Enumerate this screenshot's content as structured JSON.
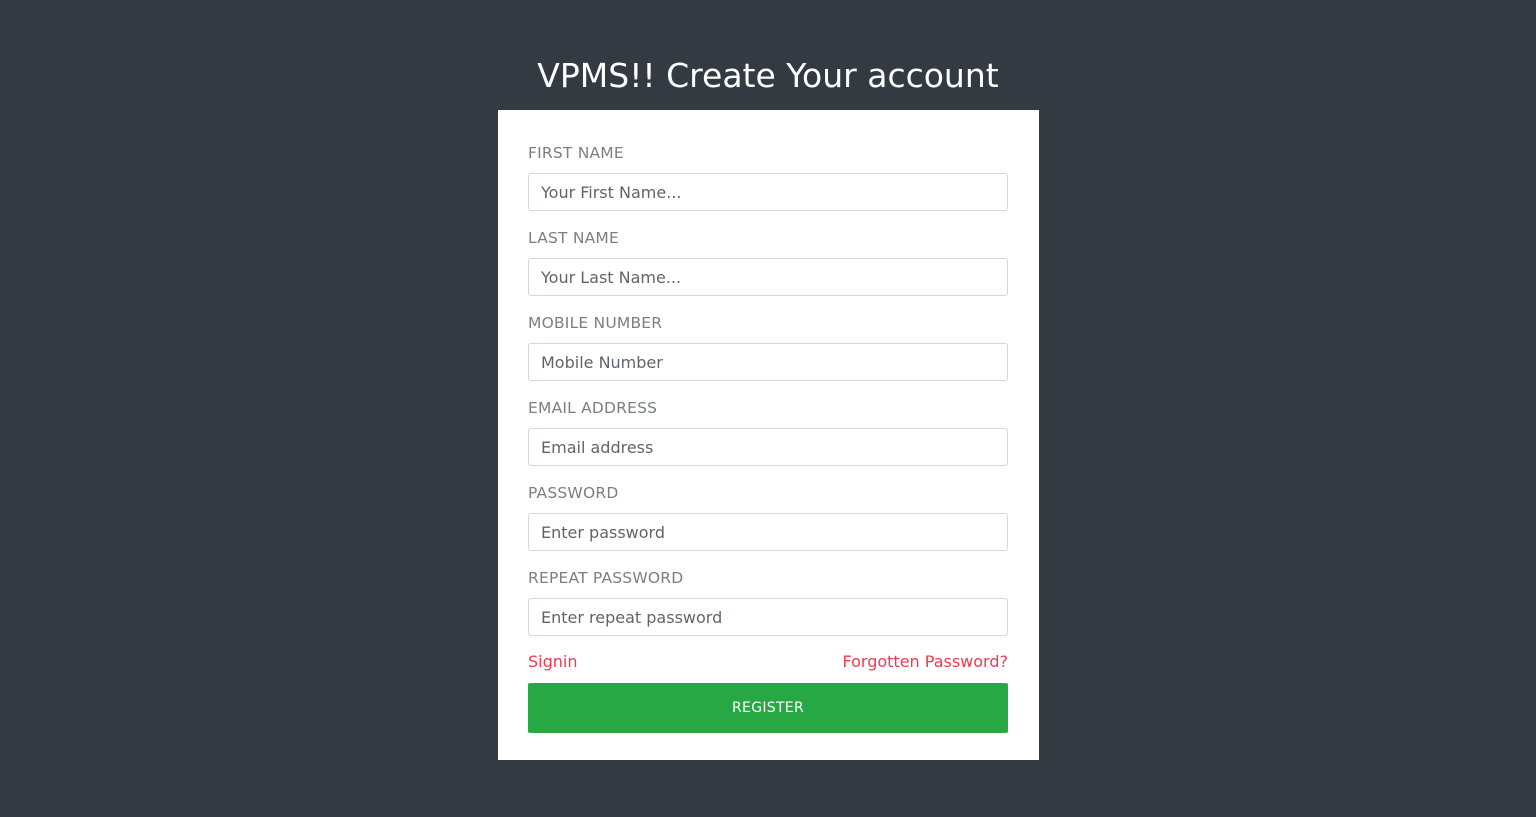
{
  "page": {
    "title": "VPMS!! Create Your account"
  },
  "form": {
    "fields": [
      {
        "label": "FIRST NAME",
        "placeholder": "Your First Name...",
        "value": ""
      },
      {
        "label": "LAST NAME",
        "placeholder": "Your Last Name...",
        "value": ""
      },
      {
        "label": "MOBILE NUMBER",
        "placeholder": "Mobile Number",
        "value": ""
      },
      {
        "label": "EMAIL ADDRESS",
        "placeholder": "Email address",
        "value": ""
      },
      {
        "label": "PASSWORD",
        "placeholder": "Enter password",
        "value": ""
      },
      {
        "label": "REPEAT PASSWORD",
        "placeholder": "Enter repeat password",
        "value": ""
      }
    ],
    "signin_link": "Signin",
    "forgot_link": "Forgotten Password?",
    "register_label": "REGISTER"
  },
  "colors": {
    "background": "#343a42",
    "card": "#ffffff",
    "link": "#ef3a4f",
    "register_button": "#28a745"
  }
}
